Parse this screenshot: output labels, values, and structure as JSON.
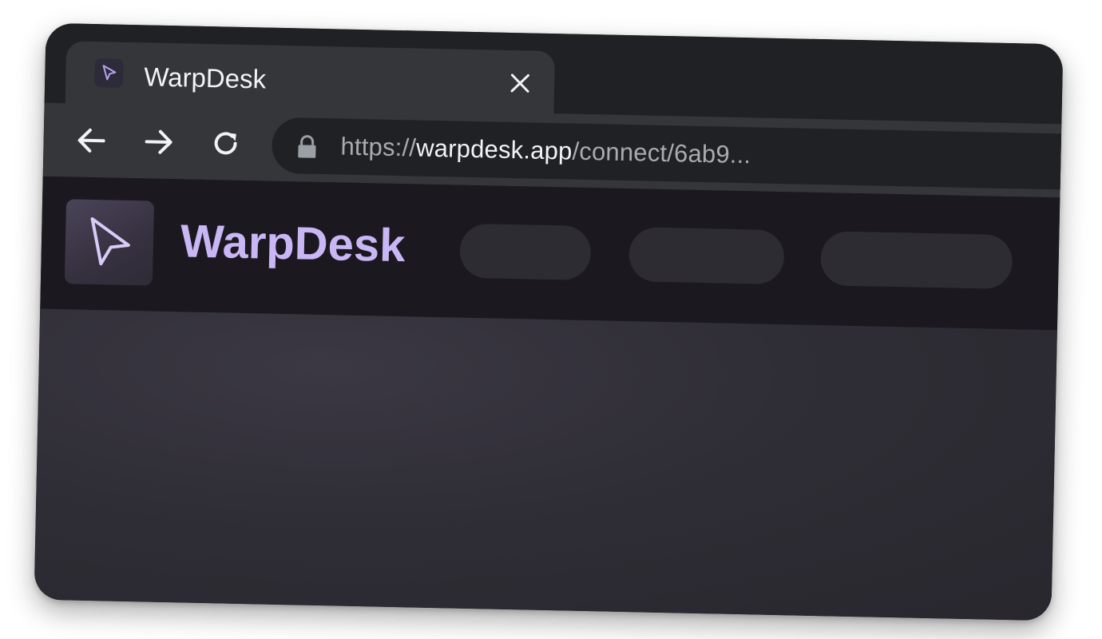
{
  "browser": {
    "tab": {
      "title": "WarpDesk",
      "favicon": "cursor-arrow-icon",
      "close_icon": "close-icon"
    },
    "toolbar": {
      "back_icon": "arrow-left-icon",
      "forward_icon": "arrow-right-icon",
      "reload_icon": "reload-icon",
      "lock_icon": "lock-icon",
      "url_scheme": "https://",
      "url_host": "warpdesk.app",
      "url_path": "/connect/6ab9..."
    }
  },
  "app": {
    "brand_name": "WarpDesk",
    "logo_icon": "cursor-arrow-icon",
    "nav_pills": [
      {
        "label": ""
      },
      {
        "label": ""
      },
      {
        "label": ""
      }
    ]
  },
  "colors": {
    "brand_accent": "#c9b6f5",
    "chrome_dark": "#202124",
    "chrome_toolbar": "#35363a",
    "header_bg": "#1b191f",
    "content_bg": "#2f2d35"
  }
}
